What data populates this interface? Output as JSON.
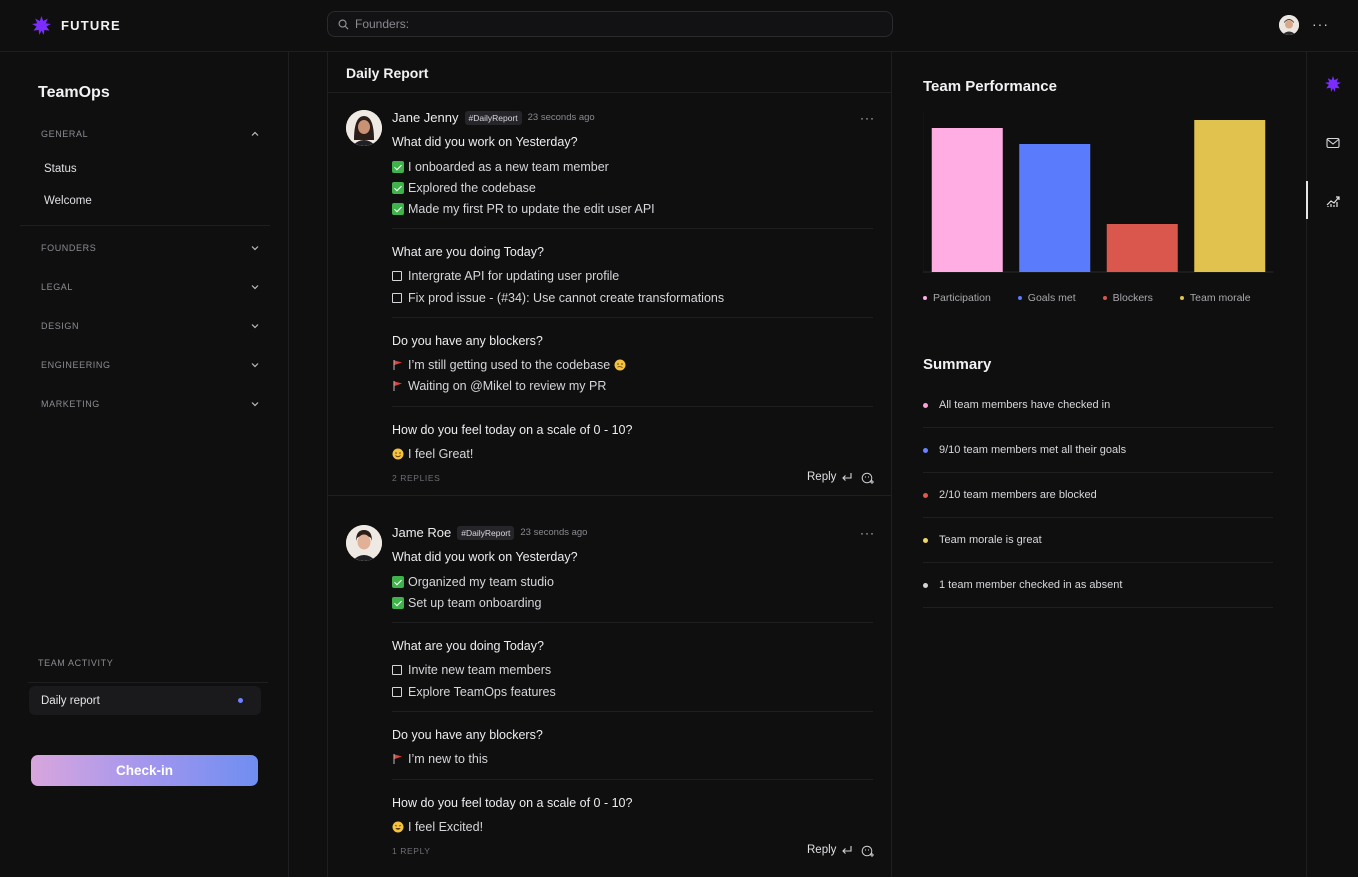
{
  "app": {
    "logo_text": "FUTURE",
    "search_placeholder": "Founders:",
    "brand_color": "#7b2cff"
  },
  "sidebar": {
    "brand": "TeamOps",
    "general": {
      "label": "GENERAL",
      "items": [
        "Status",
        "Welcome"
      ]
    },
    "sections": [
      "FOUNDERS",
      "LEGAL",
      "DESIGN",
      "ENGINEERING",
      "MARKETING"
    ],
    "team_activity_label": "TEAM ACTIVITY",
    "daily_report_label": "Daily report",
    "checkin_label": "Check-in"
  },
  "feed": {
    "title": "Daily Report",
    "posts": [
      {
        "author": "Jane Jenny",
        "tag": "#DailyReport",
        "time": "23 seconds ago",
        "q1": "What did you work on Yesterday?",
        "done": [
          "I onboarded as a new team member",
          "Explored the codebase",
          "Made my first PR to update the edit user API"
        ],
        "q2": "What are you doing Today?",
        "todo": [
          "Intergrate API for updating user profile",
          "Fix prod issue - (#34): Use cannot create transformations"
        ],
        "q3": "Do you have any blockers?",
        "blockers": [
          "I’m still getting used to the codebase",
          "Waiting on @Mikel to review my PR"
        ],
        "q4": "How do you feel today on a scale of 0 - 10?",
        "feeling": "I feel Great!",
        "replies": "2 REPLIES",
        "reply_label": "Reply"
      },
      {
        "author": "Jame Roe",
        "tag": "#DailyReport",
        "time": "23 seconds ago",
        "q1": "What did you work on Yesterday?",
        "done": [
          "Organized my team studio",
          "Set up team onboarding"
        ],
        "q2": "What are you doing Today?",
        "todo": [
          "Invite new team members",
          "Explore TeamOps features"
        ],
        "q3": "Do you have any blockers?",
        "blockers": [
          "I’m new to this"
        ],
        "q4": "How do you feel today on a scale of 0 - 10?",
        "feeling": "I feel Excited!",
        "replies": "1 REPLY",
        "reply_label": "Reply"
      }
    ]
  },
  "right": {
    "perf_title": "Team Performance",
    "summary_title": "Summary",
    "summary": [
      {
        "text": "All team members have checked in",
        "color": "#ff9fd8"
      },
      {
        "text": "9/10 team members met all their goals",
        "color": "#6b83ff"
      },
      {
        "text": "2/10 team members are blocked",
        "color": "#e4584c"
      },
      {
        "text": "Team morale is great",
        "color": "#f1d56a"
      },
      {
        "text": "1 team member checked in as absent",
        "color": "#d4d4d8"
      }
    ]
  },
  "chart_data": {
    "type": "bar",
    "categories": [
      "Participation",
      "Goals met",
      "Blockers",
      "Team morale"
    ],
    "values": [
      90,
      80,
      30,
      95
    ],
    "ylim": [
      0,
      100
    ],
    "colors": [
      "#ffade2",
      "#5b7bfd",
      "#d9574c",
      "#e1c24f"
    ],
    "grid": false,
    "legend": "bottom"
  }
}
